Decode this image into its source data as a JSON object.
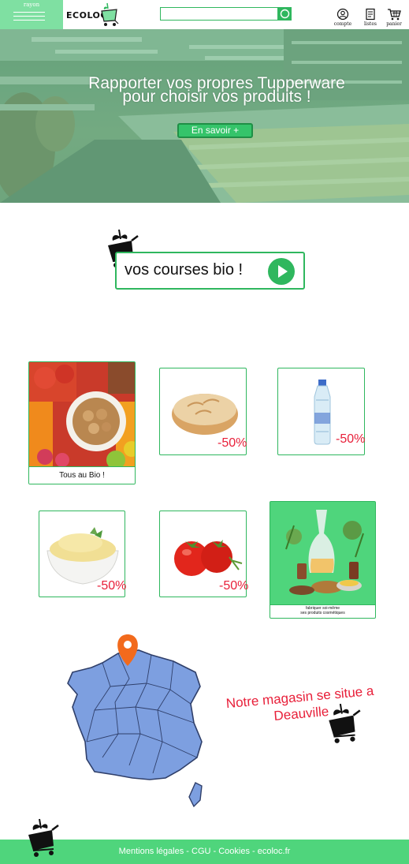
{
  "header": {
    "rayon_label": "rayon",
    "logo_text": "ECOLOC",
    "search": {
      "value": "",
      "placeholder": ""
    },
    "icons": [
      {
        "name": "account-icon",
        "label": "compte"
      },
      {
        "name": "lists-icon",
        "label": "listes"
      },
      {
        "name": "cart-icon",
        "label": "panier"
      }
    ]
  },
  "hero": {
    "title": "Rapporter vos propres Tupperware pour choisir vos produits !",
    "button_label": "En savoir +"
  },
  "cta": {
    "label": "vos courses bio !",
    "icon": "play-icon"
  },
  "products": [
    {
      "id": "bio",
      "caption": "Tous au Bio !",
      "image": "fruits-nuts"
    },
    {
      "id": "bread",
      "promo": "-50%",
      "image": "bread-loaf"
    },
    {
      "id": "water",
      "promo": "-50%",
      "image": "water-bottle"
    },
    {
      "id": "puree",
      "promo": "-50%",
      "image": "mashed-potatoes"
    },
    {
      "id": "tomato",
      "promo": "-50%",
      "image": "tomatoes"
    },
    {
      "id": "cosmetics",
      "caption_line1": "fabriquer soi-même",
      "caption_line2": "ses produits cosmétiques",
      "image": "cosmetics"
    }
  ],
  "store": {
    "text": "Notre magasin se situe a Deauville",
    "map_icon": "location-pin-icon"
  },
  "footer": {
    "text": "Mentions légales - CGU - Cookies - ecoloc.fr"
  },
  "colors": {
    "brand_green": "#2fb75e",
    "light_green": "#7fe0a2",
    "footer_green": "#4fd57c",
    "promo_red": "#e8203a",
    "map_blue": "#7d9fe0"
  }
}
